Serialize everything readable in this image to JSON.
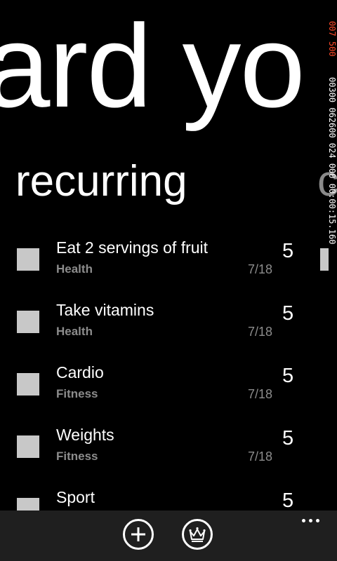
{
  "header": {
    "big_title": "ard yo",
    "pivot_current": "recurring",
    "pivot_next": "c"
  },
  "perf_counter": {
    "line1": "007 500",
    "line2": "00300 062600 024 000 00:00:15.160"
  },
  "items": [
    {
      "title": "Eat 2 servings of fruit",
      "category": "Health",
      "date": "7/18",
      "points": "5"
    },
    {
      "title": "Take vitamins",
      "category": "Health",
      "date": "7/18",
      "points": "5"
    },
    {
      "title": "Cardio",
      "category": "Fitness",
      "date": "7/18",
      "points": "5"
    },
    {
      "title": "Weights",
      "category": "Fitness",
      "date": "7/18",
      "points": "5"
    },
    {
      "title": "Sport",
      "category": "",
      "date": "",
      "points": "5"
    }
  ],
  "appbar": {
    "add_icon": "add-icon",
    "rewards_icon": "crown-icon",
    "more_icon": "ellipsis-icon"
  },
  "colors": {
    "background": "#000000",
    "checkbox": "#c8c8c8",
    "secondary_text": "#8c8c8c",
    "appbar": "#1f1f1f",
    "perf_counter": "#ff4a2a"
  }
}
